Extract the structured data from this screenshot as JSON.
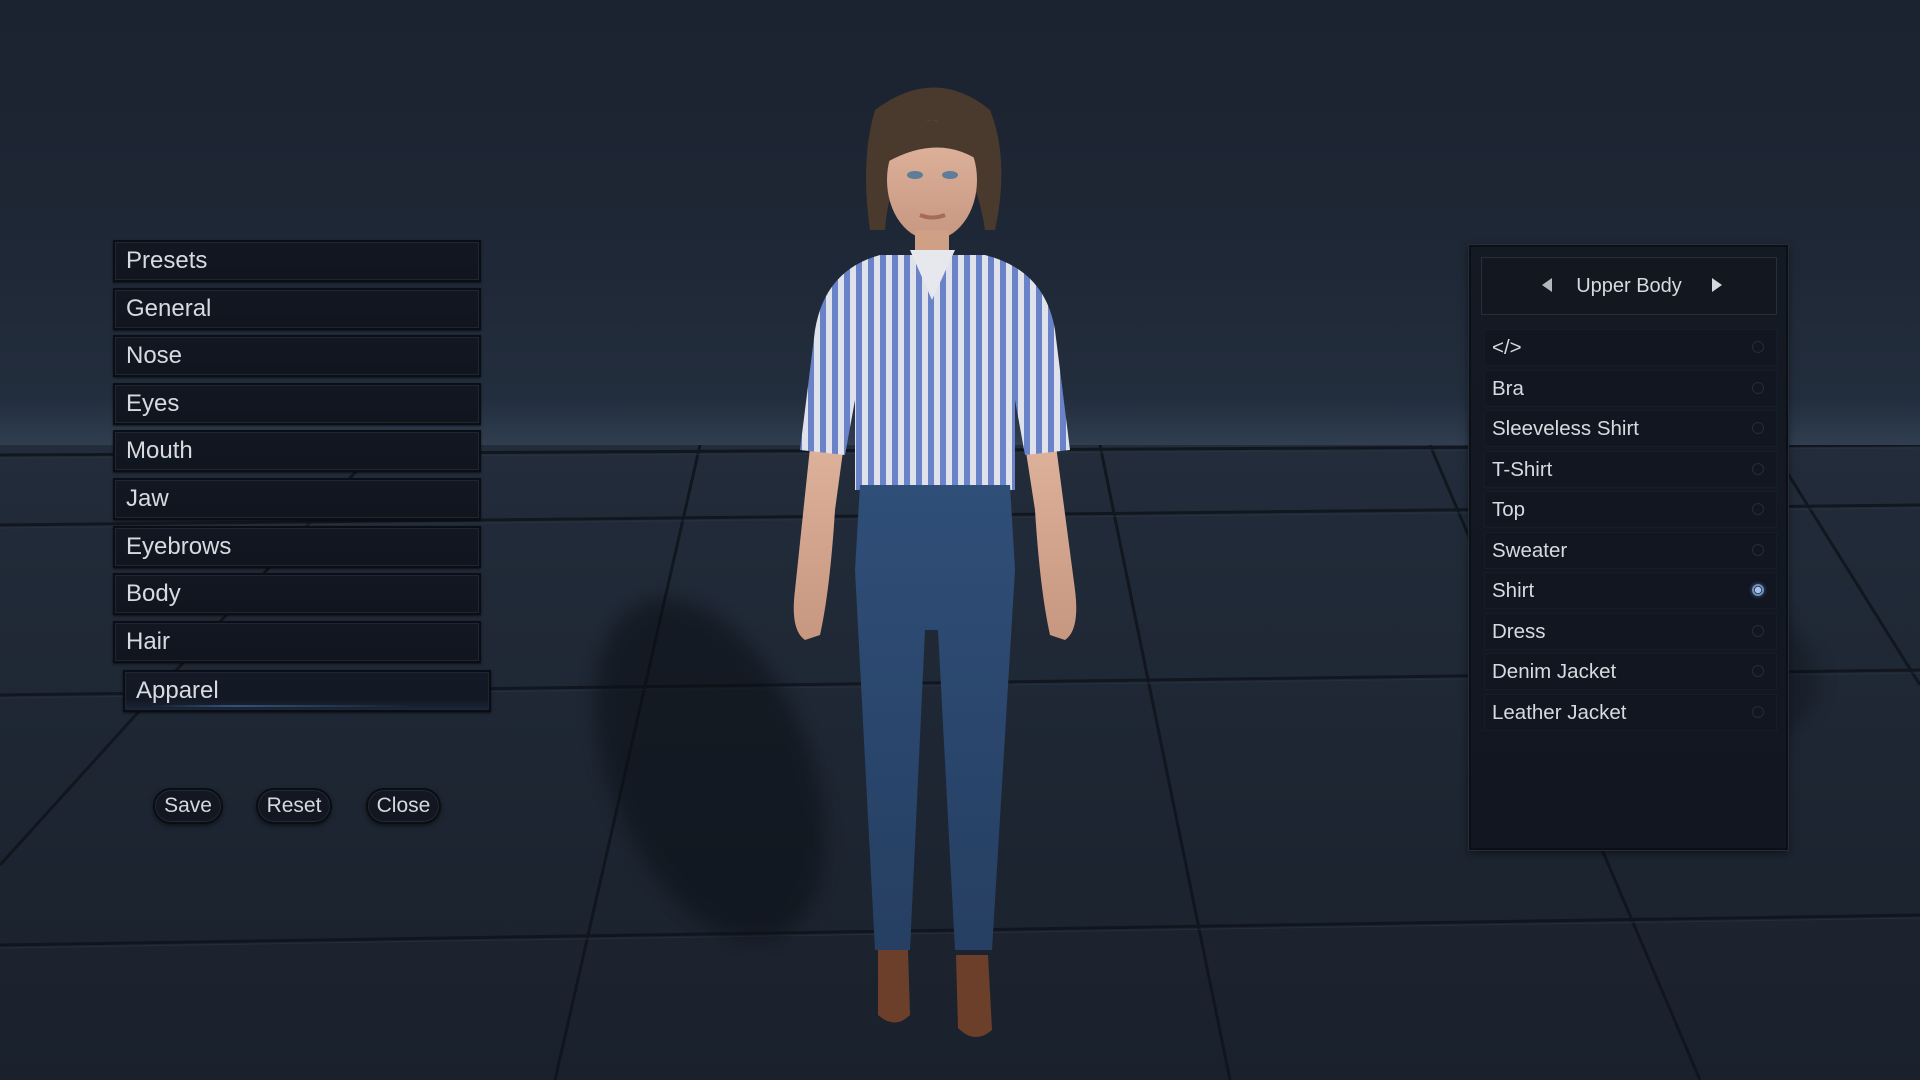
{
  "left_menu": {
    "items": [
      {
        "label": "Presets"
      },
      {
        "label": "General"
      },
      {
        "label": "Nose"
      },
      {
        "label": "Eyes"
      },
      {
        "label": "Mouth"
      },
      {
        "label": "Jaw"
      },
      {
        "label": "Eyebrows"
      },
      {
        "label": "Body"
      },
      {
        "label": "Hair"
      },
      {
        "label": "Apparel",
        "active": true
      }
    ]
  },
  "actions": {
    "save": "Save",
    "reset": "Reset",
    "close": "Close"
  },
  "apparel_panel": {
    "category": "Upper Body",
    "prev_icon": "triangle-left-icon",
    "next_icon": "triangle-right-icon",
    "options": [
      {
        "label": "</>",
        "selected": false
      },
      {
        "label": "Bra",
        "selected": false
      },
      {
        "label": "Sleeveless Shirt",
        "selected": false
      },
      {
        "label": "T-Shirt",
        "selected": false
      },
      {
        "label": "Top",
        "selected": false
      },
      {
        "label": "Sweater",
        "selected": false
      },
      {
        "label": "Shirt",
        "selected": true
      },
      {
        "label": "Dress",
        "selected": false
      },
      {
        "label": "Denim Jacket",
        "selected": false
      },
      {
        "label": "Leather Jacket",
        "selected": false
      }
    ]
  },
  "colors": {
    "accent_selected": "#6f8fc4",
    "text": "#d7dbe0",
    "panel_bg": "#121722",
    "scene_bg": "#1d2430"
  }
}
